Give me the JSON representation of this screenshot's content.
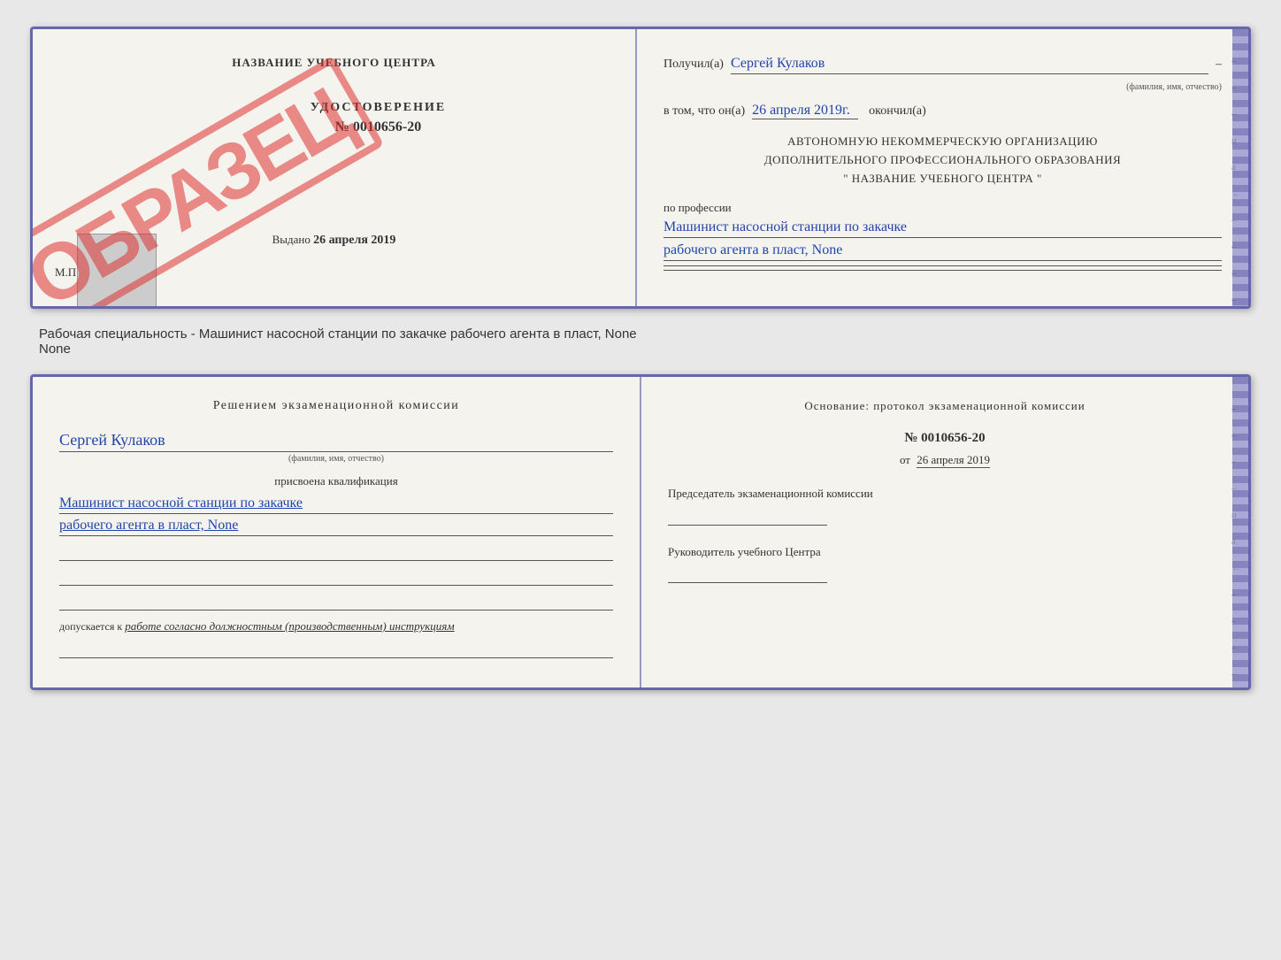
{
  "document1": {
    "left": {
      "title": "НАЗВАНИЕ УЧЕБНОГО ЦЕНТРА",
      "obrazec_label": "ОБРАЗЕЦ",
      "cert_type": "УДОСТОВЕРЕНИЕ",
      "cert_number": "№ 0010656-20",
      "issued_label": "Выдано",
      "issued_date": "26 апреля 2019",
      "mp_label": "М.П."
    },
    "right": {
      "received_label": "Получил(а)",
      "person_name": "Сергей Кулаков",
      "name_sublabel": "(фамилия, имя, отчество)",
      "date_prefix": "в том, что он(а)",
      "date_value": "26 апреля 2019г.",
      "date_suffix": "окончил(а)",
      "org_line1": "АВТОНОМНУЮ НЕКОММЕРЧЕСКУЮ ОРГАНИЗАЦИЮ",
      "org_line2": "ДОПОЛНИТЕЛЬНОГО ПРОФЕССИОНАЛЬНОГО ОБРАЗОВАНИЯ",
      "org_line3": "\"  НАЗВАНИЕ УЧЕБНОГО ЦЕНТРА  \"",
      "profession_label": "по профессии",
      "profession_line1": "Машинист насосной станции по закачке",
      "profession_line2": "рабочего агента в пласт, None",
      "side_marks": [
        "-",
        "-",
        "-",
        "-",
        "и",
        "а",
        "←",
        "-",
        "-",
        "-",
        "-",
        "-"
      ]
    }
  },
  "description": "Рабочая специальность - Машинист насосной станции по закачке рабочего агента в пласт, None",
  "document2": {
    "left": {
      "commission_title": "Решением экзаменационной комиссии",
      "person_name": "Сергей Кулаков",
      "name_sublabel": "(фамилия, имя, отчество)",
      "assigned_label": "присвоена квалификация",
      "qual_line1": "Машинист насосной станции по закачке",
      "qual_line2": "рабочего агента в пласт, None",
      "dopusk_prefix": "допускается к",
      "dopusk_italic": "работе согласно должностным (производственным) инструкциям"
    },
    "right": {
      "osnov_title": "Основание: протокол экзаменационной комиссии",
      "protocol_number": "№ 0010656-20",
      "date_prefix": "от",
      "date_value": "26 апреля 2019",
      "chairman_label": "Председатель экзаменационной комиссии",
      "director_label": "Руководитель учебного Центра",
      "side_marks": [
        "-",
        "-",
        "-",
        "-",
        "и",
        "а",
        "←",
        "-",
        "-",
        "-",
        "-",
        "-"
      ]
    }
  }
}
